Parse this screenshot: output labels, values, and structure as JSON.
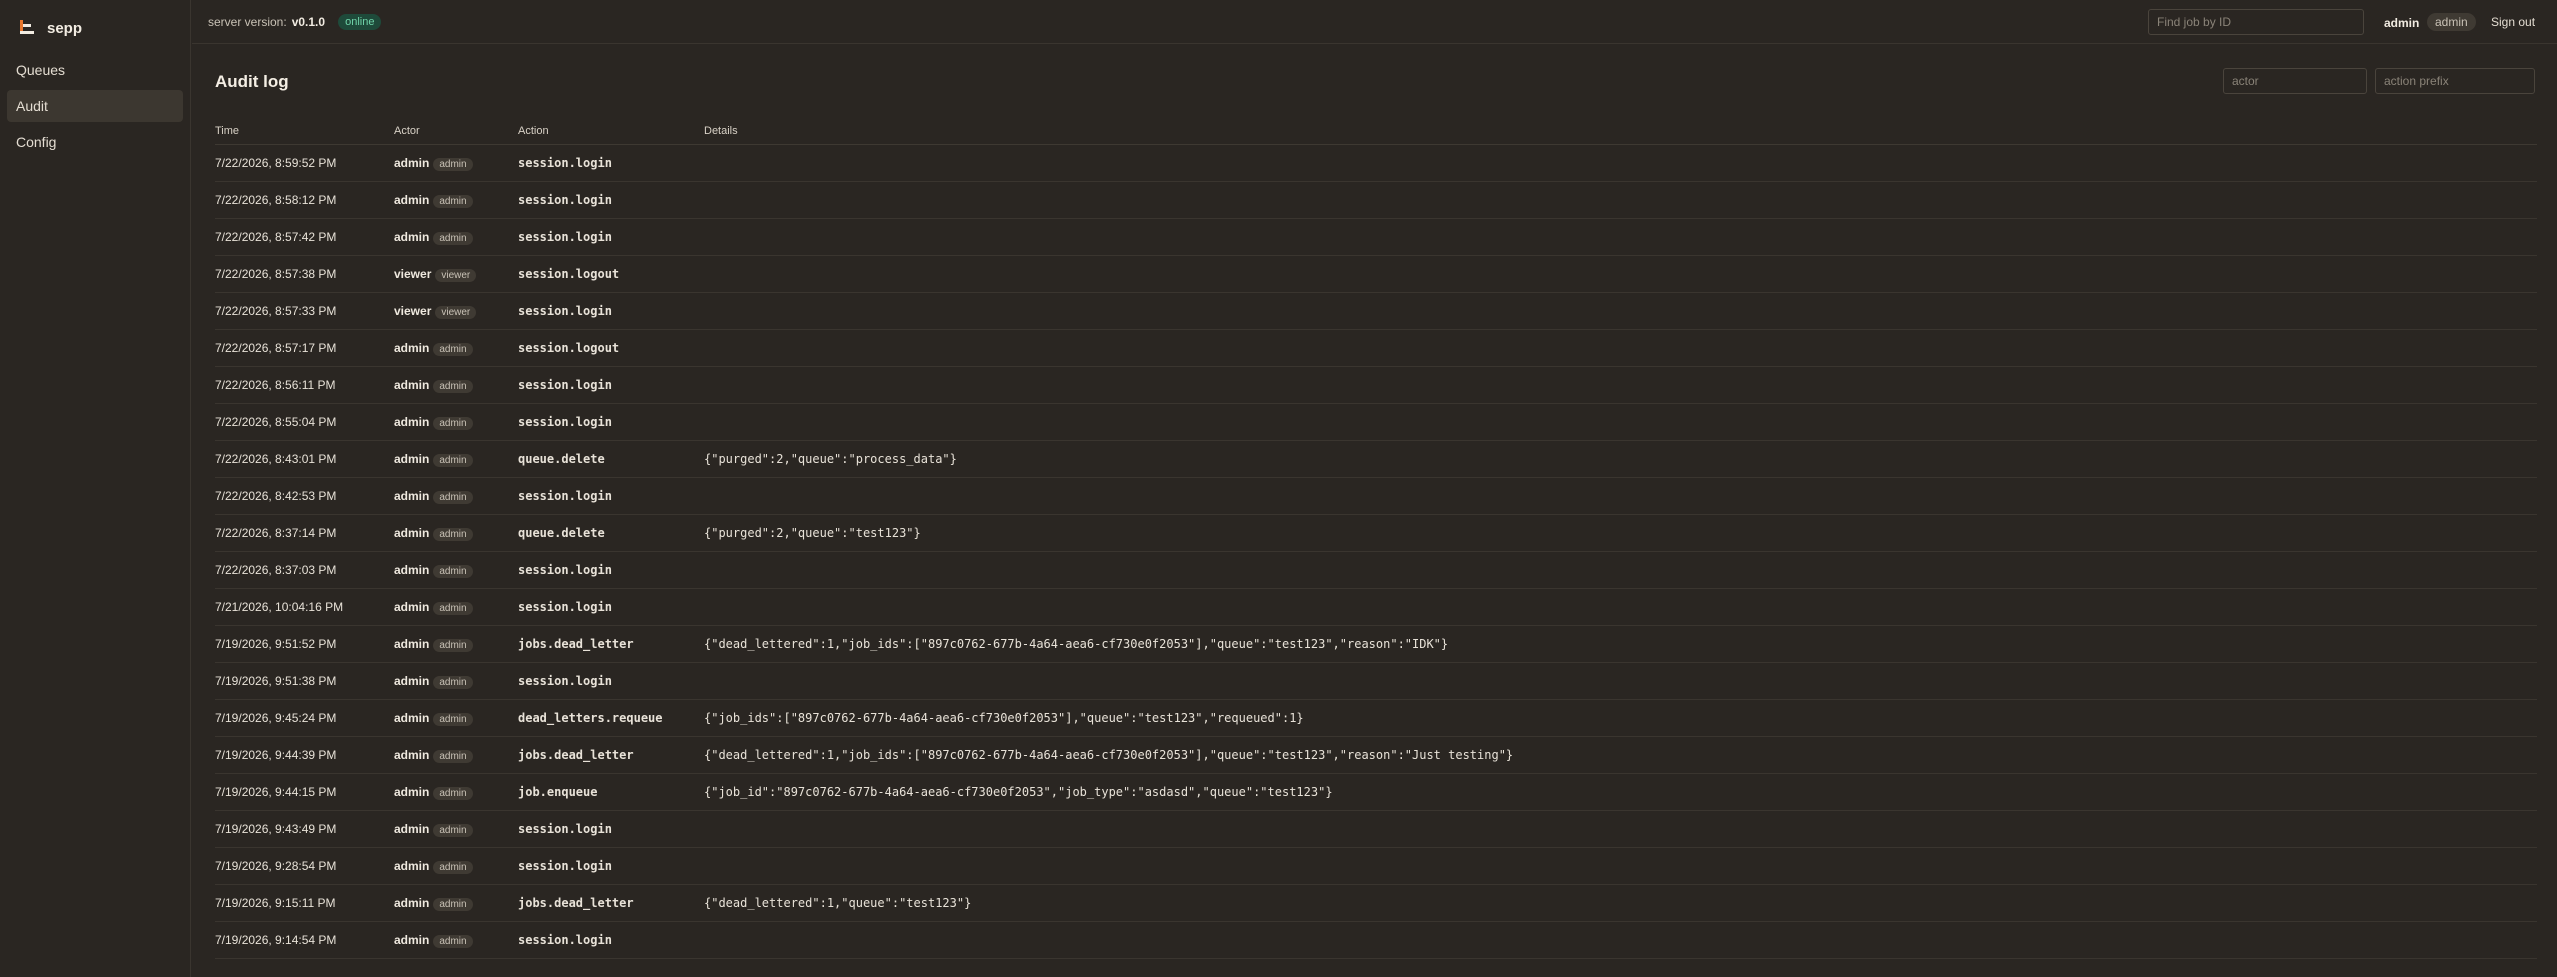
{
  "app": {
    "name": "sepp",
    "icon": "sepp-logo-icon"
  },
  "sidebar": {
    "items": [
      {
        "label": "Queues",
        "active": false
      },
      {
        "label": "Audit",
        "active": true
      },
      {
        "label": "Config",
        "active": false
      }
    ]
  },
  "topbar": {
    "server_version_label": "server version:",
    "server_version": "v0.1.0",
    "status": "online",
    "find_job_placeholder": "Find job by ID",
    "user_name": "admin",
    "user_role": "admin",
    "signout_label": "Sign out"
  },
  "audit": {
    "title": "Audit log",
    "actor_placeholder": "actor",
    "action_prefix_placeholder": "action prefix",
    "columns": [
      "Time",
      "Actor",
      "Action",
      "Details"
    ],
    "rows": [
      {
        "time": "7/22/2026, 8:59:52 PM",
        "actor": "admin",
        "role": "admin",
        "action": "session.login",
        "details": ""
      },
      {
        "time": "7/22/2026, 8:58:12 PM",
        "actor": "admin",
        "role": "admin",
        "action": "session.login",
        "details": ""
      },
      {
        "time": "7/22/2026, 8:57:42 PM",
        "actor": "admin",
        "role": "admin",
        "action": "session.login",
        "details": ""
      },
      {
        "time": "7/22/2026, 8:57:38 PM",
        "actor": "viewer",
        "role": "viewer",
        "action": "session.logout",
        "details": ""
      },
      {
        "time": "7/22/2026, 8:57:33 PM",
        "actor": "viewer",
        "role": "viewer",
        "action": "session.login",
        "details": ""
      },
      {
        "time": "7/22/2026, 8:57:17 PM",
        "actor": "admin",
        "role": "admin",
        "action": "session.logout",
        "details": ""
      },
      {
        "time": "7/22/2026, 8:56:11 PM",
        "actor": "admin",
        "role": "admin",
        "action": "session.login",
        "details": ""
      },
      {
        "time": "7/22/2026, 8:55:04 PM",
        "actor": "admin",
        "role": "admin",
        "action": "session.login",
        "details": ""
      },
      {
        "time": "7/22/2026, 8:43:01 PM",
        "actor": "admin",
        "role": "admin",
        "action": "queue.delete",
        "details": "{\"purged\":2,\"queue\":\"process_data\"}"
      },
      {
        "time": "7/22/2026, 8:42:53 PM",
        "actor": "admin",
        "role": "admin",
        "action": "session.login",
        "details": ""
      },
      {
        "time": "7/22/2026, 8:37:14 PM",
        "actor": "admin",
        "role": "admin",
        "action": "queue.delete",
        "details": "{\"purged\":2,\"queue\":\"test123\"}"
      },
      {
        "time": "7/22/2026, 8:37:03 PM",
        "actor": "admin",
        "role": "admin",
        "action": "session.login",
        "details": ""
      },
      {
        "time": "7/21/2026, 10:04:16 PM",
        "actor": "admin",
        "role": "admin",
        "action": "session.login",
        "details": ""
      },
      {
        "time": "7/19/2026, 9:51:52 PM",
        "actor": "admin",
        "role": "admin",
        "action": "jobs.dead_letter",
        "details": "{\"dead_lettered\":1,\"job_ids\":[\"897c0762-677b-4a64-aea6-cf730e0f2053\"],\"queue\":\"test123\",\"reason\":\"IDK\"}"
      },
      {
        "time": "7/19/2026, 9:51:38 PM",
        "actor": "admin",
        "role": "admin",
        "action": "session.login",
        "details": ""
      },
      {
        "time": "7/19/2026, 9:45:24 PM",
        "actor": "admin",
        "role": "admin",
        "action": "dead_letters.requeue",
        "details": "{\"job_ids\":[\"897c0762-677b-4a64-aea6-cf730e0f2053\"],\"queue\":\"test123\",\"requeued\":1}"
      },
      {
        "time": "7/19/2026, 9:44:39 PM",
        "actor": "admin",
        "role": "admin",
        "action": "jobs.dead_letter",
        "details": "{\"dead_lettered\":1,\"job_ids\":[\"897c0762-677b-4a64-aea6-cf730e0f2053\"],\"queue\":\"test123\",\"reason\":\"Just testing\"}"
      },
      {
        "time": "7/19/2026, 9:44:15 PM",
        "actor": "admin",
        "role": "admin",
        "action": "job.enqueue",
        "details": "{\"job_id\":\"897c0762-677b-4a64-aea6-cf730e0f2053\",\"job_type\":\"asdasd\",\"queue\":\"test123\"}"
      },
      {
        "time": "7/19/2026, 9:43:49 PM",
        "actor": "admin",
        "role": "admin",
        "action": "session.login",
        "details": ""
      },
      {
        "time": "7/19/2026, 9:28:54 PM",
        "actor": "admin",
        "role": "admin",
        "action": "session.login",
        "details": ""
      },
      {
        "time": "7/19/2026, 9:15:11 PM",
        "actor": "admin",
        "role": "admin",
        "action": "jobs.dead_letter",
        "details": "{\"dead_lettered\":1,\"queue\":\"test123\"}"
      },
      {
        "time": "7/19/2026, 9:14:54 PM",
        "actor": "admin",
        "role": "admin",
        "action": "session.login",
        "details": ""
      }
    ]
  }
}
